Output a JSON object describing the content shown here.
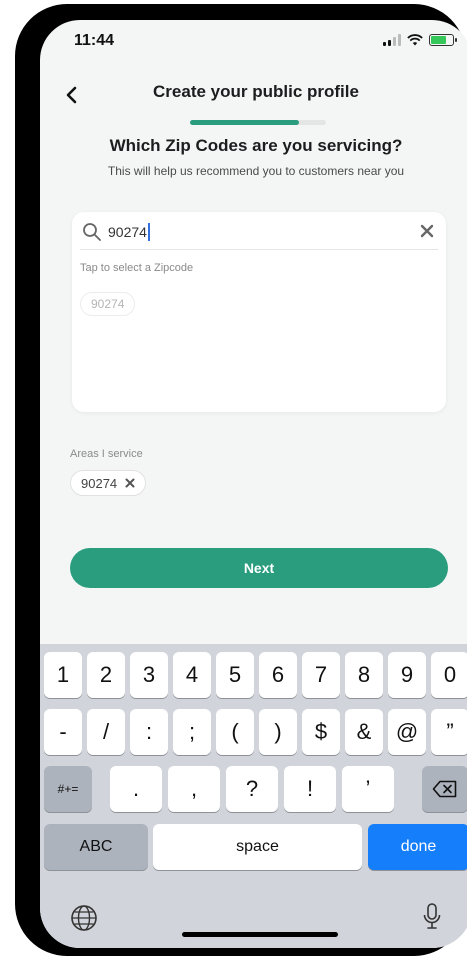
{
  "status_bar": {
    "time": "11:44"
  },
  "header": {
    "title": "Create your public profile",
    "progress_fraction": 0.8
  },
  "question": "Which Zip Codes are you servicing?",
  "subtext": "This will help us recommend you to customers near you",
  "search": {
    "value": "90274",
    "tap_label": "Tap to select a Zipcode",
    "suggestions": [
      "90274"
    ]
  },
  "areas": {
    "label": "Areas I service",
    "selected": [
      "90274"
    ]
  },
  "next_button": "Next",
  "keyboard": {
    "row1": [
      "1",
      "2",
      "3",
      "4",
      "5",
      "6",
      "7",
      "8",
      "9",
      "0"
    ],
    "row2": [
      "-",
      "/",
      ":",
      ";",
      "(",
      ")",
      "$",
      "&",
      "@",
      "”"
    ],
    "row3_left": "#+=",
    "row3": [
      ".",
      ",",
      "?",
      "!",
      "’"
    ],
    "abc": "ABC",
    "space": "space",
    "done": "done"
  },
  "colors": {
    "accent": "#2a9d7f",
    "done_key": "#157efb",
    "caret": "#2f6fe0"
  }
}
